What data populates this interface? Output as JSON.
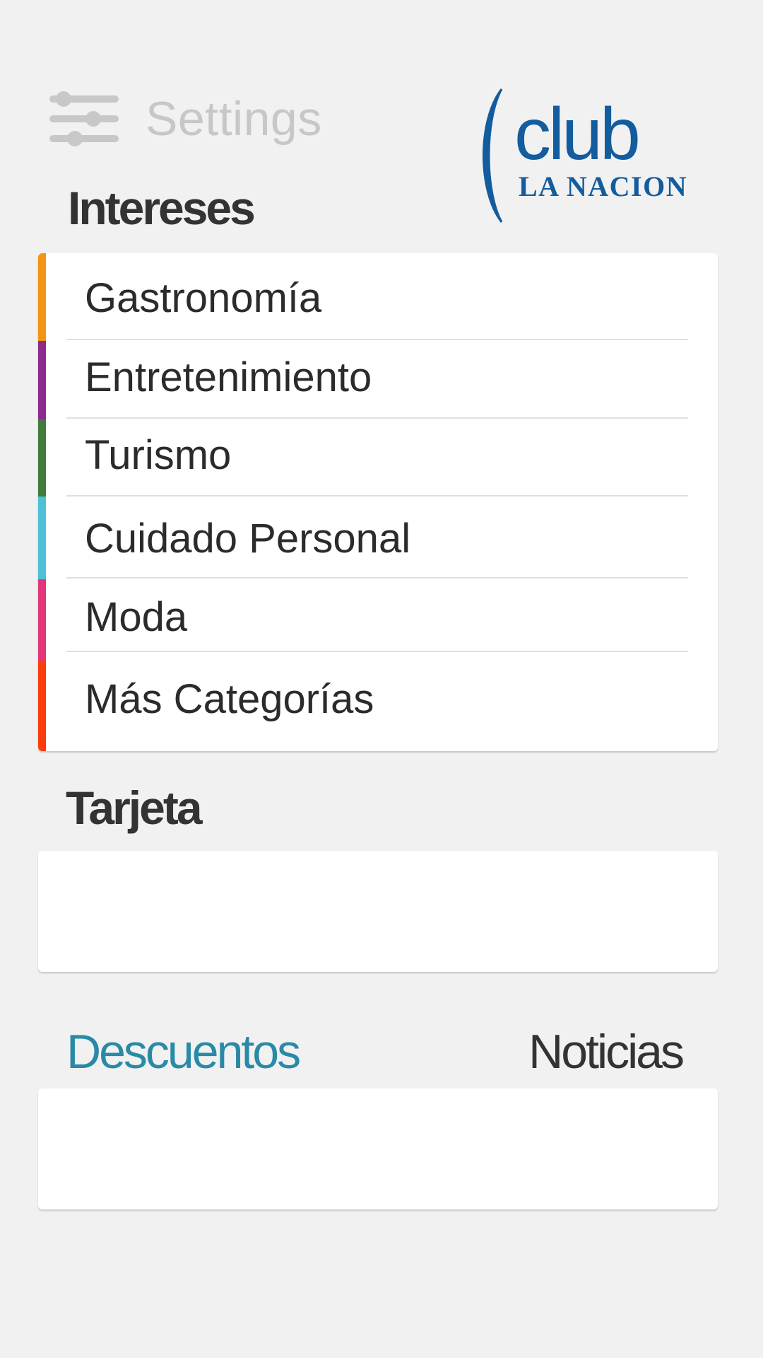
{
  "header": {
    "settings_label": "Settings",
    "settings_icon": "sliders-icon",
    "logo": {
      "club": "club",
      "subtitle": "LA NACION",
      "color": "#135c9e"
    }
  },
  "interests": {
    "title": "Intereses",
    "items": [
      {
        "label": "Gastronomía",
        "color": "#f39416"
      },
      {
        "label": "Entretenimiento",
        "color": "#8e2a8c"
      },
      {
        "label": "Turismo",
        "color": "#407d3c"
      },
      {
        "label": "Cuidado Personal",
        "color": "#4ec1d7"
      },
      {
        "label": "Moda",
        "color": "#e33676"
      },
      {
        "label": "Más Categorías",
        "color": "#fa3c0f"
      }
    ]
  },
  "card": {
    "title": "Tarjeta"
  },
  "tabs": {
    "items": [
      {
        "label": "Descuentos",
        "active": true,
        "color": "#2a8aa6"
      },
      {
        "label": "Noticias",
        "active": false,
        "color": "#333333"
      }
    ]
  }
}
